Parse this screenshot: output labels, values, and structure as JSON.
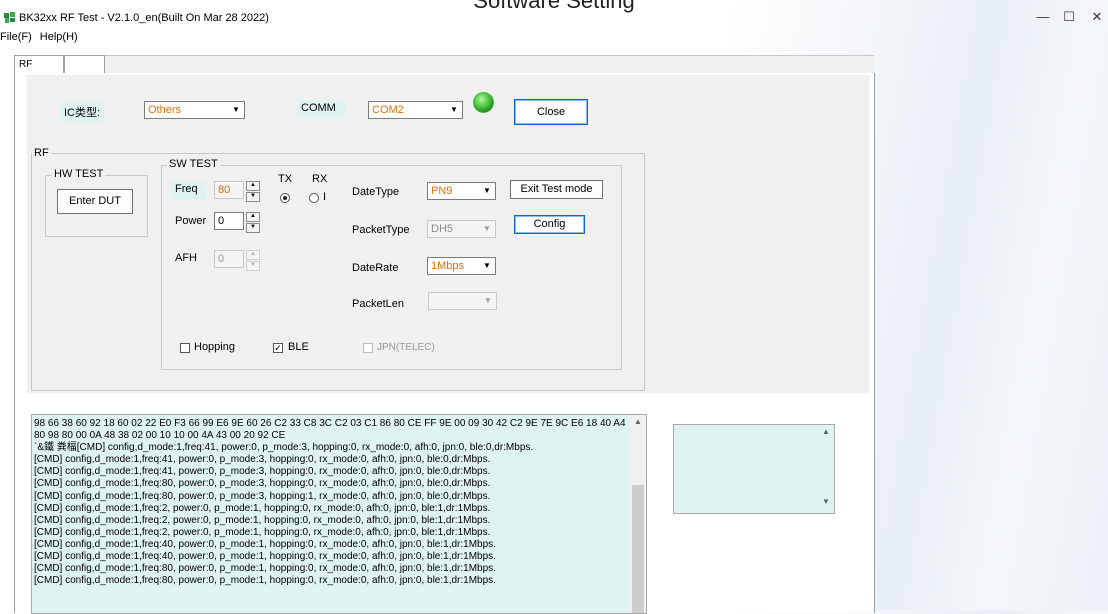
{
  "background_title": "Software Setting",
  "window": {
    "title": "BK32xx RF Test - V2.1.0_en(Built On Mar 28 2022)",
    "minimize": "—",
    "maximize": "☐",
    "close": "✕"
  },
  "menu": {
    "file": "File(F)",
    "help": "Help(H)"
  },
  "tabs": [
    {
      "label": "RF TEST"
    },
    {
      "label": ""
    }
  ],
  "top": {
    "ic_label": "IC类型:",
    "ic_value": "Others",
    "comm_label": "COMM",
    "comm_value": "COM2",
    "status_color": "#2fb52f",
    "close_button": "Close"
  },
  "rf_group": "RF",
  "hw_test": {
    "title": "HW TEST",
    "enter_dut": "Enter DUT"
  },
  "sw_test": {
    "title": "SW TEST",
    "freq_label": "Freq",
    "freq_value": "80",
    "power_label": "Power",
    "power_value": "0",
    "afh_label": "AFH",
    "afh_value": "0",
    "tx_label": "TX",
    "rx_label": "RX",
    "rx_radio_label": "I",
    "datetype_label": "DateType",
    "datetype_value": "PN9",
    "packettype_label": "PacketType",
    "packettype_value": "DH5",
    "daterate_label": "DateRate",
    "daterate_value": "1Mbps",
    "packetlen_label": "PacketLen",
    "packetlen_value": "",
    "exit_test_mode": "Exit Test mode",
    "config": "Config",
    "hopping_label": "Hopping",
    "hopping_checked": false,
    "ble_label": "BLE",
    "ble_checked": true,
    "jpn_label": "JPN(TELEC)",
    "jpn_checked": false,
    "check_mark": "✓"
  },
  "log": {
    "text": "98 66 38 60 92 18 60 02 22 E0 F3 66 99 E6 9E 60 26 C2 33 C8 3C C2 03 C1 86 80 CE FF 9E 00 09 30 42 C2 9E 7E 9C E6 18 40 A4 80 98 80 00 0A 48 38 02 00 10 10 00 4A 43 00 20 92 CE\n`&鐵 粪楅[CMD] config,d_mode:1,freq:41, power:0, p_mode:3, hopping:0, rx_mode:0, afh:0, jpn:0, ble:0,dr:Mbps.\n[CMD] config,d_mode:1,freq:41, power:0, p_mode:3, hopping:0, rx_mode:0, afh:0, jpn:0, ble:0,dr:Mbps.\n[CMD] config,d_mode:1,freq:41, power:0, p_mode:3, hopping:0, rx_mode:0, afh:0, jpn:0, ble:0,dr:Mbps.\n[CMD] config,d_mode:1,freq:80, power:0, p_mode:3, hopping:0, rx_mode:0, afh:0, jpn:0, ble:0,dr:Mbps.\n[CMD] config,d_mode:1,freq:80, power:0, p_mode:3, hopping:1, rx_mode:0, afh:0, jpn:0, ble:0,dr:Mbps.\n[CMD] config,d_mode:1,freq:2, power:0, p_mode:1, hopping:0, rx_mode:0, afh:0, jpn:0, ble:1,dr:1Mbps.\n[CMD] config,d_mode:1,freq:2, power:0, p_mode:1, hopping:0, rx_mode:0, afh:0, jpn:0, ble:1,dr:1Mbps.\n[CMD] config,d_mode:1,freq:2, power:0, p_mode:1, hopping:0, rx_mode:0, afh:0, jpn:0, ble:1,dr:1Mbps.\n[CMD] config,d_mode:1,freq:40, power:0, p_mode:1, hopping:0, rx_mode:0, afh:0, jpn:0, ble:1,dr:1Mbps.\n[CMD] config,d_mode:1,freq:40, power:0, p_mode:1, hopping:0, rx_mode:0, afh:0, jpn:0, ble:1,dr:1Mbps.\n[CMD] config,d_mode:1,freq:80, power:0, p_mode:1, hopping:0, rx_mode:0, afh:0, jpn:0, ble:1,dr:1Mbps.\n[CMD] config,d_mode:1,freq:80, power:0, p_mode:1, hopping:0, rx_mode:0, afh:0, jpn:0, ble:1,dr:1Mbps."
  }
}
